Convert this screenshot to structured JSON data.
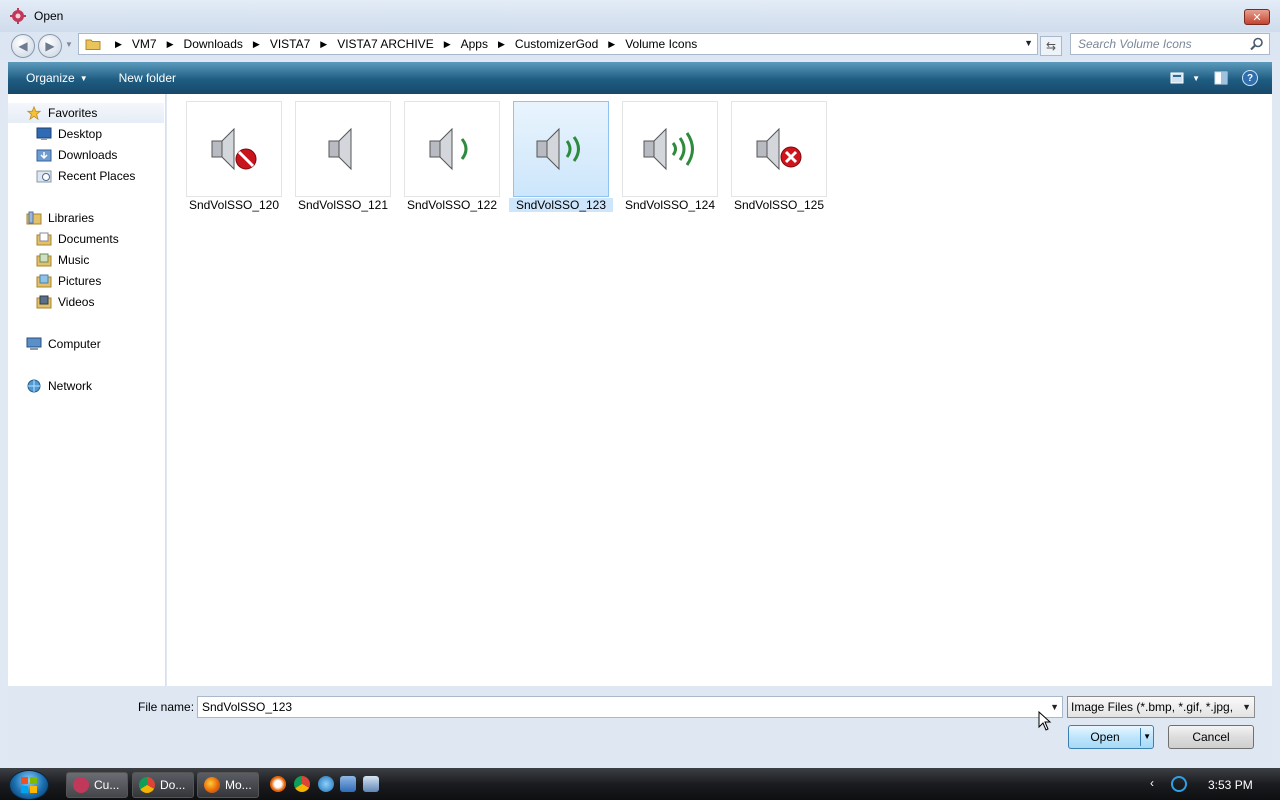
{
  "window": {
    "title": "Open"
  },
  "address": {
    "crumbs": [
      "VM7",
      "Downloads",
      "VISTA7",
      "VISTA7 ARCHIVE",
      "Apps",
      "CustomizerGod",
      "Volume Icons"
    ]
  },
  "search": {
    "placeholder": "Search Volume Icons"
  },
  "toolbar": {
    "organize_label": "Organize",
    "new_folder_label": "New folder"
  },
  "navpane": {
    "favorites": "Favorites",
    "fav_items": [
      "Desktop",
      "Downloads",
      "Recent Places"
    ],
    "libraries": "Libraries",
    "lib_items": [
      "Documents",
      "Music",
      "Pictures",
      "Videos"
    ],
    "computer": "Computer",
    "network": "Network"
  },
  "files": [
    {
      "name": "SndVolSSO_120",
      "icon": "speaker-muted-icon"
    },
    {
      "name": "SndVolSSO_121",
      "icon": "speaker-icon"
    },
    {
      "name": "SndVolSSO_122",
      "icon": "speaker-low-icon"
    },
    {
      "name": "SndVolSSO_123",
      "icon": "speaker-medium-icon",
      "selected": true
    },
    {
      "name": "SndVolSSO_124",
      "icon": "speaker-high-icon"
    },
    {
      "name": "SndVolSSO_125",
      "icon": "speaker-error-icon"
    }
  ],
  "bottom": {
    "file_name_label": "File name:",
    "file_name_value": "SndVolSSO_123",
    "file_type_value": "Image Files (*.bmp, *.gif, *.jpg,",
    "open_label": "Open",
    "cancel_label": "Cancel"
  },
  "taskbar": {
    "tasks": [
      "Cu...",
      "Do...",
      "Mo..."
    ],
    "clock": "3:53 PM"
  },
  "colors": {
    "accent_toolbar": "#1f5c82",
    "selection": "#cde6fb",
    "speaker_wave": "#2e8b3e",
    "error_red": "#d0141c"
  }
}
